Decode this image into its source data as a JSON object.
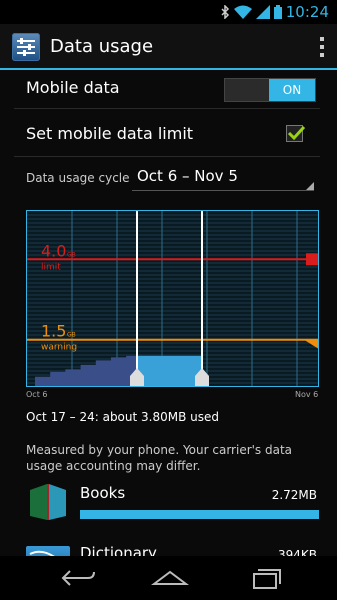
{
  "status_bar": {
    "time": "10:24"
  },
  "action_bar": {
    "title": "Data usage"
  },
  "settings": {
    "mobile_data": {
      "label": "Mobile data",
      "toggle": "ON"
    },
    "mobile_data_limit": {
      "label": "Set mobile data limit",
      "checked": true
    },
    "cycle": {
      "label": "Data usage cycle",
      "value": "Oct 6 – Nov 5"
    }
  },
  "chart": {
    "limit": {
      "value": "4.0",
      "unit": "GB",
      "label": "limit",
      "color": "#d91c1c"
    },
    "warning": {
      "value": "1.5",
      "unit": "GB",
      "label": "warning",
      "color": "#f08d0a"
    },
    "axis_start": "Oct 6",
    "axis_end": "Nov 6"
  },
  "chart_data": {
    "type": "area",
    "x_range": [
      "Oct 6",
      "Nov 6"
    ],
    "selection": [
      "Oct 17",
      "Oct 24"
    ],
    "ylim": [
      0,
      5.5
    ],
    "series": [
      {
        "values": [
          0.35,
          0.5,
          0.58,
          0.72,
          0.86,
          0.95,
          1.0
        ]
      }
    ]
  },
  "summary": "Oct 17 – 24: about 3.80MB used",
  "note": "Measured by your phone. Your carrier's data usage accounting may differ.",
  "apps": [
    {
      "name": "Books",
      "size": "2.72MB",
      "usage_fraction": 1.0
    },
    {
      "name": "Dictionary",
      "size": "394KB"
    }
  ],
  "colors": {
    "accent": "#33b5e5",
    "limit": "#d91c1c",
    "warning": "#f08d0a"
  },
  "icons": {
    "bluetooth": "bluetooth-icon",
    "wifi": "wifi-icon",
    "signal": "signal-icon",
    "battery": "battery-icon",
    "back": "back-icon",
    "home": "home-icon",
    "recents": "recents-icon"
  }
}
